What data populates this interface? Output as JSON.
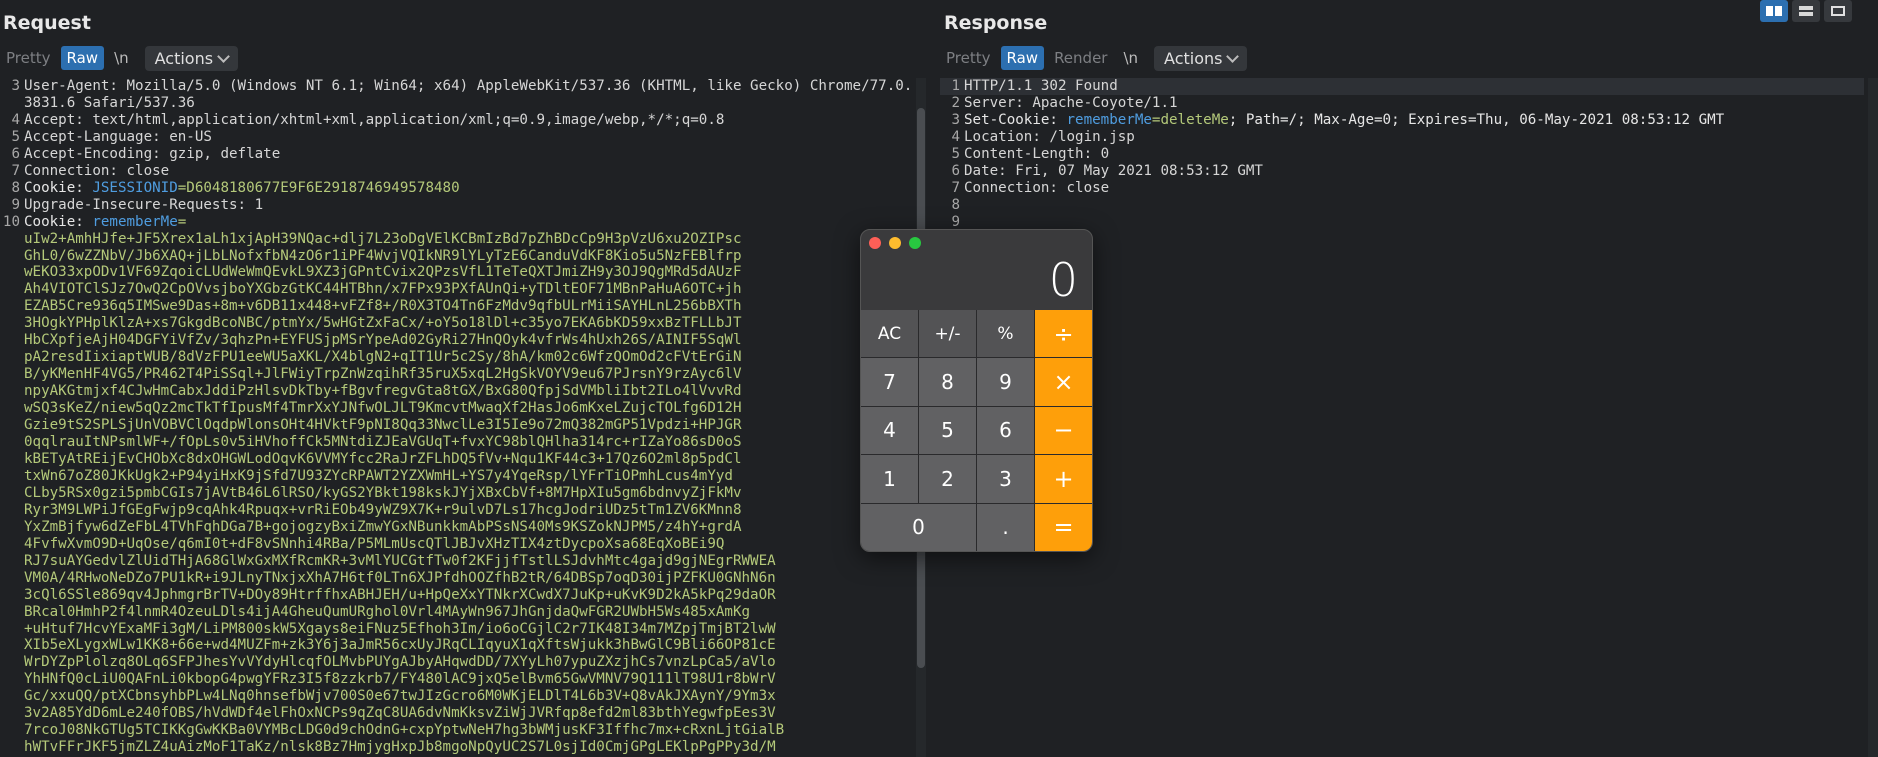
{
  "request": {
    "title": "Request",
    "toolbar": {
      "pretty": "Pretty",
      "raw": "Raw",
      "newline": "\\n",
      "actions": "Actions"
    },
    "lines": [
      {
        "num": "3",
        "text": "User-Agent: Mozilla/5.0 (Windows NT 6.1; Win64; x64) AppleWebKit/537.36 (KHTML, like Gecko) Chrome/77.0.3831.6 Safari/537.36"
      },
      {
        "num": "4",
        "text": "Accept: text/html,application/xhtml+xml,application/xml;q=0.9,image/webp,*/*;q=0.8"
      },
      {
        "num": "5",
        "text": "Accept-Language: en-US"
      },
      {
        "num": "6",
        "text": "Accept-Encoding: gzip, deflate"
      },
      {
        "num": "7",
        "text": "Connection: close"
      },
      {
        "num": "8",
        "key": "Cookie: ",
        "cname": "JSESSIONID",
        "cval": "=D6048180677E9F6E2918746949578480"
      },
      {
        "num": "9",
        "text": "Upgrade-Insecure-Requests: 1"
      },
      {
        "num": "10",
        "key": "Cookie: ",
        "cname": "rememberMe",
        "cval": "="
      }
    ],
    "cookie_blob": [
      "uIw2+AmhHJfe+JF5Xrex1aLh1xjApH39NQac+dlj7L23oDgVElKCBmIzBd7pZhBDcCp9H3pVzU6xu2OZIPsc",
      "GhL0/6wZZNbV/Jb6XAQ+jLbLNofxfbN4zO6r1iPF4WvjVQIkNR9lYLyTzE6CanduVdKF8Kio5u5NzFEBlfrp",
      "wEKO33xpODv1VF69ZqoicLUdWeWmQEvkL9XZ3jGPntCvix2QPzsVfL1TeTeQXTJmiZH9y3OJ9QgMRd5dAUzF",
      "Ah4VIOTClSJz7OwQ2CpOVvsjboYXGbzGtKC44HTBhn/x7FPx93PXfAUnQi+yTDltEOF71MBnPaHuA6OTC+jh",
      "EZAB5Cre936q5IMSwe9Das+8m+v6DB11x448+vFZf8+/R0X3TO4Tn6FzMdv9qfbULrMiiSAYHLnL256bBXTh",
      "3HOgkYPHplKlzA+xs7GkgdBcoNBC/ptmYx/5wHGtZxFaCx/+oY5o18lDl+c35yo7EKA6bKD59xxBzTFLLbJT",
      "HbCXpfjeAjH04DGFYiVfZv/3qhzPn+EYFUSjpMSrYpeAd02GyRi27HnQOyk4vfrWs4hUxh26S/AINIF5SqWl",
      "pA2resdIixiaptWUB/8dVzFPU1eeWU5aXKL/X4blgN2+qIT1Ur5c2Sy/8hA/km02c6WfzQOmOd2cFVtErGiN",
      "B/yKMenHF4VG5/PR462T4PiSSql+JlFWiyTrpZnWzqihRf35ruX5xqL2HgSkVOYV9eu67PJrsnY9rzAyc6lV",
      "npyAKGtmjxf4CJwHmCabxJddiPzHlsvDkTby+fBgvfregvGta8tGX/BxG80QfpjSdVMbliIbt2ILo4lVvvRd",
      "wSQ3sKeZ/niew5qQz2mcTkTfIpusMf4TmrXxYJNfwOLJLT9KmcvtMwaqXf2HasJo6mKxeLZujcTOLfg6D12H",
      "Gzie9tS2SPLSjUnVOBVClOqdpWlonsOHt4HVktF9pNI8Qq33NwclLe3I5Ie9o72mQ382mGP51Vpdzi+HPJGR",
      "0qqlrauItNPsmlWF+/fOpLs0v5iHVhoffCk5MNtdiZJEaVGUqT+fvxYC98blQHlha314rc+rIZaYo86sD0oS",
      "kBETyAtREijEvCHObXc8dxOHGWLodOqvK6VVMYfcc2RaJrZFLhDQ5fVv+Nqu1KF44c3+17Qz6O2ml8p5pdCl",
      "txWn67oZ80JKkUgk2+P94yiHxK9jSfd7U93ZYcRPAWT2YZXWmHL+YS7y4YqeRsp/lYFrTiOPmhLcus4mYyd",
      "CLby5RSx0gzi5pmbCGIs7jAVtB46L6lRSO/kyGS2YBkt198kskJYjXBxCbVf+8M7HpXIu5gm6bdnvyZjFkMv",
      "Ryr3M9LWPiJfGEgFwjp9cqAhk4Rpuqx+vrRiEOb49yWZ9X7K+r9ulvD7Ls17hcgJodriUDz5tTm1ZV6KMnn8",
      "YxZmBjfyw6dZeFbL4TVhFqhDGa7B+gojogzyBxiZmwYGxNBunkkmAbPSsNS40Ms9KSZokNJPM5/z4hY+grdA",
      "4FvfwXvmO9D+UqOse/q6mI0t+dF8vSNnhi4RBa/P5MLmUscQTlJBJvXHzTIX4ztDycpoXsa68EqXoBEi9Q",
      "RJ7suAYGedvlZlUidTHjA68GlWxGxMXfRcmKR+3vMlYUCGtfTw0f2KFjjfTstlLSJdvhMtc4gajd9gjNEgrRWWEA",
      "VM0A/4RHwoNeDZo7PU1kR+i9JLnyTNxjxXhA7H6tf0LTn6XJPfdhOOZfhB2tR/64DBSp7oqD30ijPZFKU0GNhN6n",
      "3cQl6SSle869qv4JphmgrBrTV+DOy89HtrffhxABHJEH/u+HpQeXxYTNkrXCwdX7JuKp+uKvK9D2kA5kPq29daOR",
      "BRcal0HmhP2f4lnmR4OzeuLDls4ijA4GheuQumURghol0Vrl4MAyWn967JhGnjdaQwFGR2UWbH5Ws485xAmKg",
      "+uHtuf7HcvYExaMFi3gM/LiPM800skW5Xgays8eiFNuz5Efhoh3Im/io6oCGjlC2r7IK48I34m7MZpjTmjBT2lwW",
      "XIb5eXLygxWLw1KK8+66e+wd4MUZFm+zk3Y6j3aJmR56cxUyJRqCLIqyuX1qXftsWjukk3hBwGlC9Bli66OP81cE",
      "WrDYZpPlolzq8OLq6SFPJhesYvVYdyHlcqfOLMvbPUYgAJbyAHqwdDD/7XYyLh07ypuZXzjhCs7vnzLpCa5/aVlo",
      "YhHNfQ0cLiU0QAFnLi0kbopG4pwgYFRz3I5f8zzkrb7/FY480lAC9jxQ5elBvm65GwVMNV79Q111lT98U1r8bWrV",
      "Gc/xxuQQ/ptXCbnsyhbPLw4LNq0hnsefbWjv700S0e67twJIzGcro6M0WKjELDlT4L6b3V+Q8vAkJXAynY/9Ym3x",
      "3v2A85YdD6mLe240fOBS/hVdWDf4elFhOxNCPs9qZqC8UA6dvNmKksvZiWjJVRfqp8efd2ml83bthYegwfpEes3V",
      "7rcoJ08NkGTUg5TCIKKgGwKKBa0VYMBcLDG0d9chOdnG+cxpYptwNeH7hg3bWMjusKF3Iffhc7mx+cRxnLjtGialB",
      "hWTvFFrJKF5jmZLZ4uAizMoF1TaKz/nlsk8Bz7HmjygHxpJb8mgoNpQyUC2S7L0sjId0CmjGPgLEKlpPgPPy3d/M"
    ]
  },
  "response": {
    "title": "Response",
    "toolbar": {
      "pretty": "Pretty",
      "raw": "Raw",
      "render": "Render",
      "newline": "\\n",
      "actions": "Actions"
    },
    "lines": [
      {
        "num": "1",
        "text": "HTTP/1.1 302 Found"
      },
      {
        "num": "2",
        "text": "Server: Apache-Coyote/1.1"
      },
      {
        "num": "3",
        "key": "Set-Cookie: ",
        "cname": "rememberMe",
        "cval": "=deleteMe",
        "rest": "; Path=/; Max-Age=0; Expires=Thu, 06-May-2021 08:53:12 GMT"
      },
      {
        "num": "4",
        "text": "Location: /login.jsp"
      },
      {
        "num": "5",
        "text": "Content-Length: 0"
      },
      {
        "num": "6",
        "text": "Date: Fri, 07 May 2021 08:53:12 GMT"
      },
      {
        "num": "7",
        "text": "Connection: close"
      },
      {
        "num": "8",
        "text": ""
      },
      {
        "num": "9",
        "text": ""
      }
    ]
  },
  "calculator": {
    "display": "0",
    "keys": [
      "AC",
      "+/-",
      "%",
      "÷",
      "7",
      "8",
      "9",
      "×",
      "4",
      "5",
      "6",
      "−",
      "1",
      "2",
      "3",
      "+",
      "0",
      ".",
      "="
    ]
  }
}
